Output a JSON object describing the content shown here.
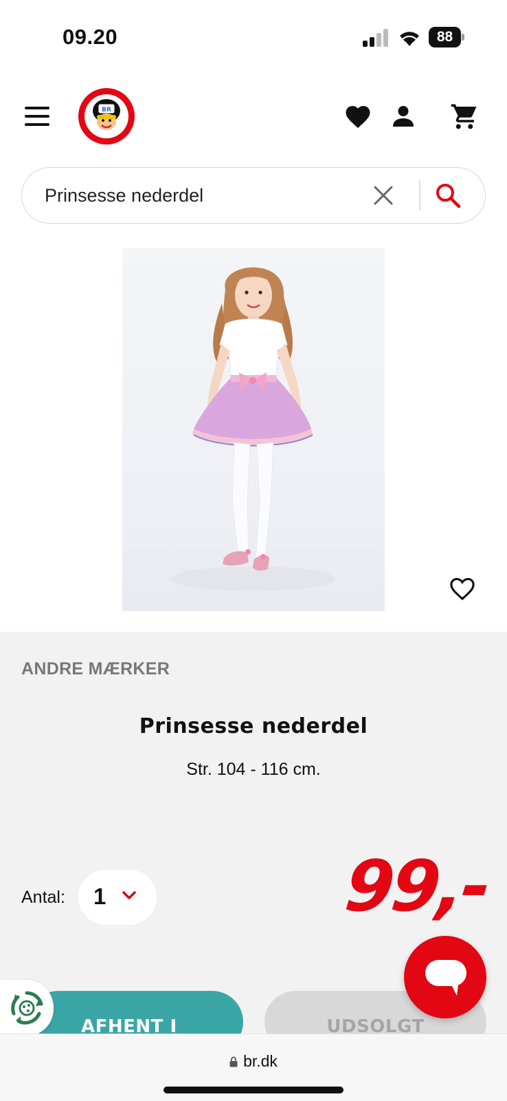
{
  "status_bar": {
    "time": "09.20",
    "battery": "88"
  },
  "header": {
    "icons": [
      "menu-icon",
      "br-logo",
      "heart-icon",
      "user-icon",
      "cart-icon"
    ]
  },
  "search": {
    "value": "Prinsesse nederdel",
    "icons": [
      "clear-icon",
      "search-icon"
    ]
  },
  "product": {
    "brand": "ANDRE MÆRKER",
    "title": "Prinsesse nederdel",
    "size": "Str. 104 - 116 cm.",
    "quantity_label": "Antal:",
    "quantity_value": "1",
    "price": "99,-"
  },
  "buttons": {
    "pickup": "AFHENT I BUTIK",
    "soldout": "UDSOLGT"
  },
  "browser": {
    "url": "br.dk"
  },
  "colors": {
    "brand_red": "#e30613",
    "teal": "#3ba6a6",
    "panel_bg": "#f2f2f2",
    "disabled_bg": "#d8d8d8"
  }
}
